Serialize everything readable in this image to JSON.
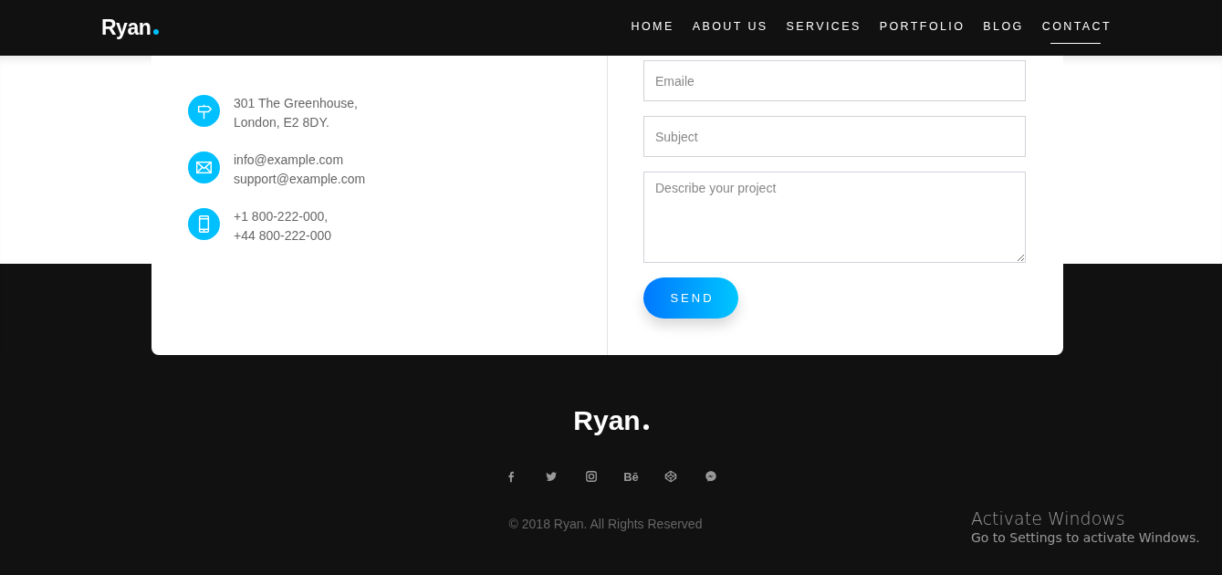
{
  "header": {
    "logo": "Ryan",
    "nav": [
      {
        "label": "HOME",
        "selected": false
      },
      {
        "label": "ABOUT US",
        "selected": false
      },
      {
        "label": "SERVICES",
        "selected": false
      },
      {
        "label": "PORTFOLIO",
        "selected": false
      },
      {
        "label": "BLOG",
        "selected": false
      },
      {
        "label": "CONTACT",
        "selected": true
      }
    ]
  },
  "contact": {
    "details": [
      {
        "kind": "address",
        "lines": [
          "301 The Greenhouse,",
          "London, E2 8DY."
        ]
      },
      {
        "kind": "email",
        "lines": [
          "info@example.com",
          "support@example.com"
        ]
      },
      {
        "kind": "phone",
        "lines": [
          "+1 800-222-000,",
          "+44 800-222-000"
        ]
      }
    ],
    "form": {
      "fields": [
        {
          "kind": "input",
          "placeholder": "Emaile"
        },
        {
          "kind": "input",
          "placeholder": "Subject"
        },
        {
          "kind": "textarea",
          "placeholder": "Describe your project"
        }
      ],
      "submit": "SEND"
    }
  },
  "footer": {
    "logo": "Ryan",
    "social": [
      {
        "kind": "facebook"
      },
      {
        "kind": "twitter"
      },
      {
        "kind": "instagram"
      },
      {
        "kind": "behance",
        "glyph": "Bē"
      },
      {
        "kind": "codepen"
      },
      {
        "kind": "messenger"
      }
    ],
    "copyright": "© 2018 Ryan. All Rights Reserved"
  },
  "os_notice": {
    "title": "Activate Windows",
    "subtitle": "Go to Settings to activate Windows."
  }
}
